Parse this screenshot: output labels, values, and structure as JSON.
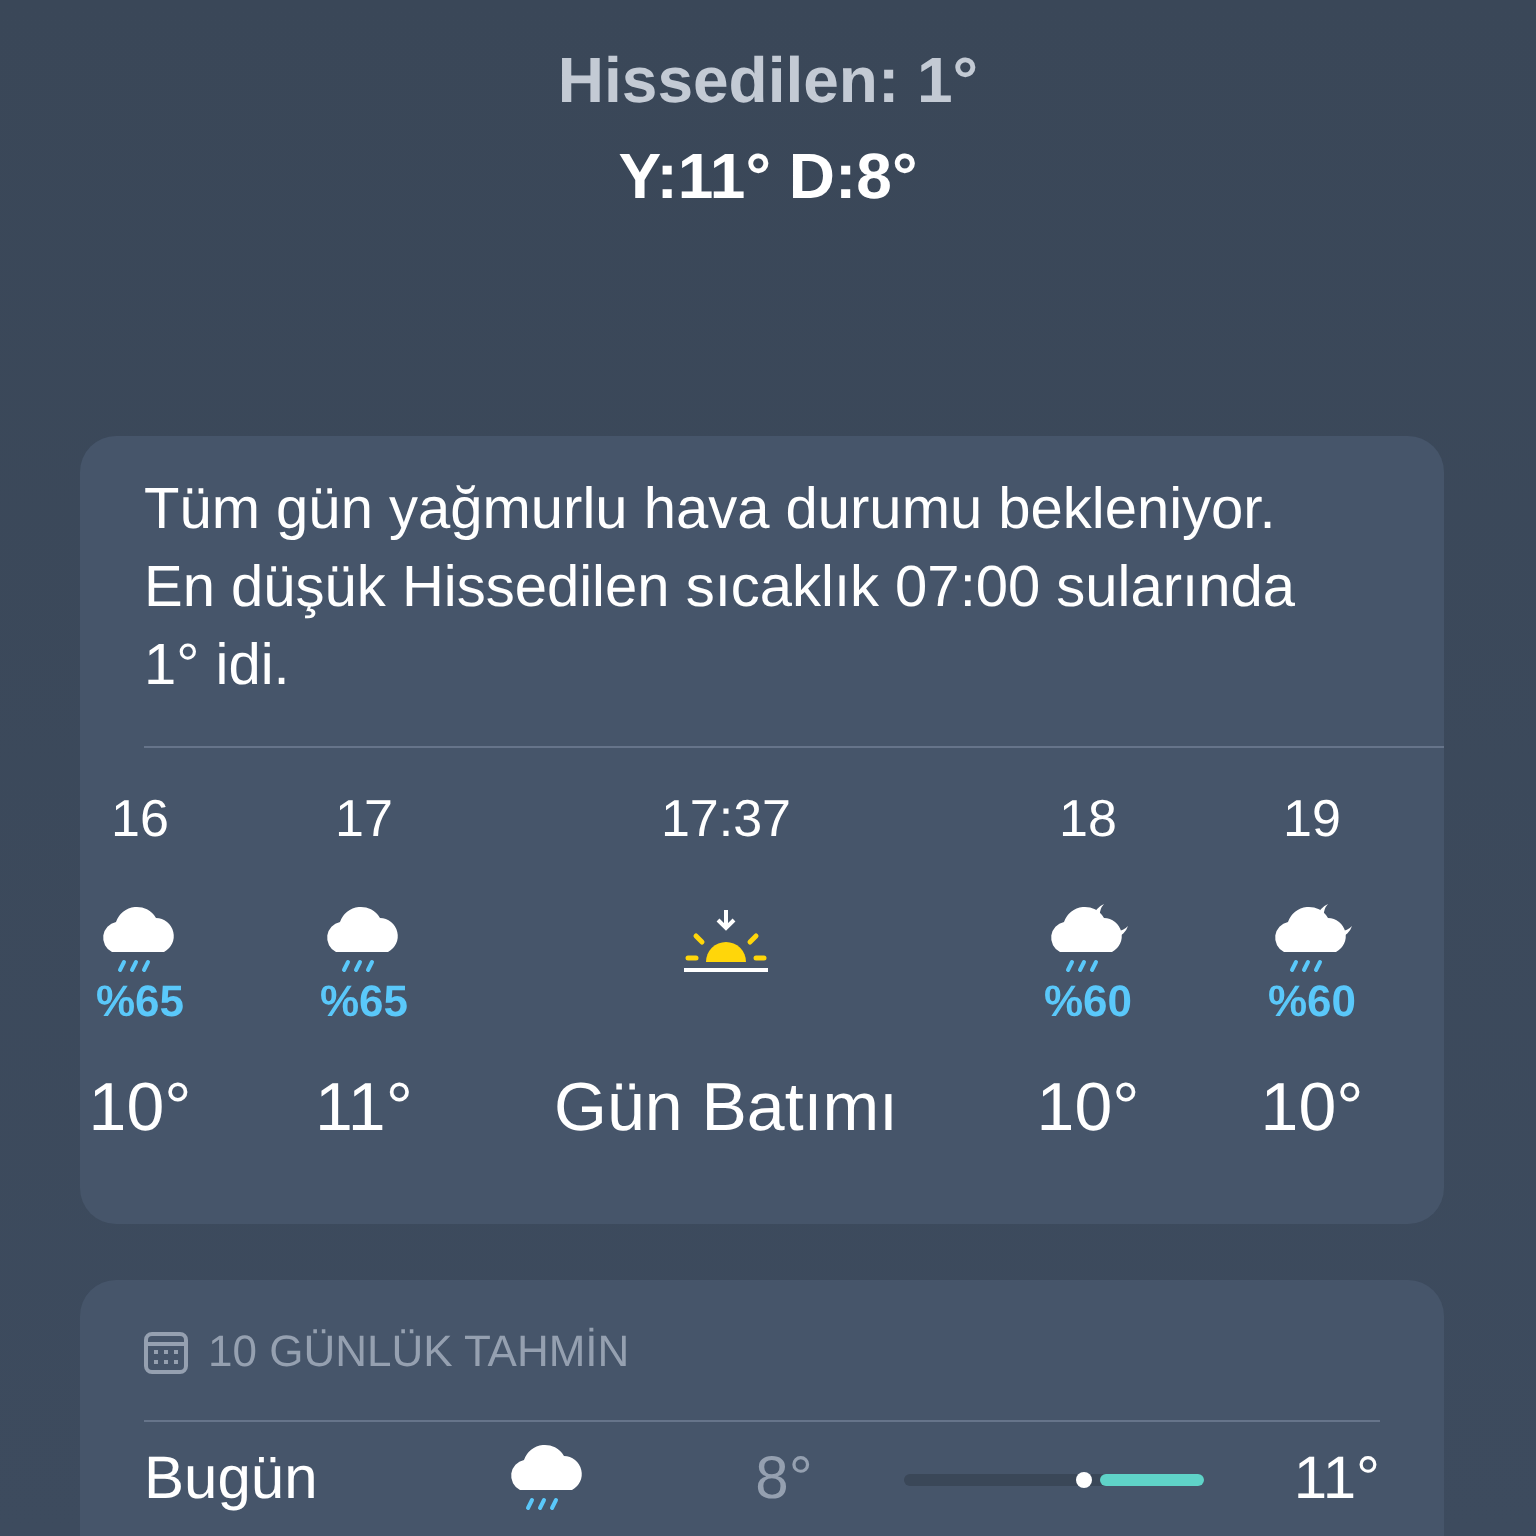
{
  "header": {
    "feels_like": "Hissedilen: 1°",
    "high_low": "Y:11° D:8°"
  },
  "hourly": {
    "summary": "Tüm gün yağmurlu hava durumu bekleniyor. En düşük Hissedilen sıcaklık 07:00 sularında 1° idi.",
    "hours": [
      {
        "kind": "rain",
        "time": "16",
        "chance": "%65",
        "temp": "10°"
      },
      {
        "kind": "rain",
        "time": "17",
        "chance": "%65",
        "temp": "11°"
      },
      {
        "kind": "sunset",
        "time": "17:37",
        "temp": "Gün Batımı"
      },
      {
        "kind": "rain-night",
        "time": "18",
        "chance": "%60",
        "temp": "10°"
      },
      {
        "kind": "rain-night",
        "time": "19",
        "chance": "%60",
        "temp": "10°"
      }
    ]
  },
  "forecast": {
    "title": "10 GÜNLÜK TAHMİN",
    "days": [
      {
        "kind": "rain",
        "day": "Bugün",
        "low": "8°",
        "high": "11°"
      }
    ]
  }
}
